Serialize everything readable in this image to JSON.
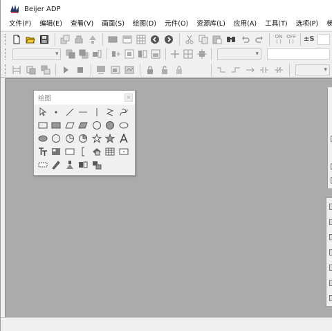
{
  "window": {
    "title": "Beijer ADP"
  },
  "menu": [
    "文件(F)",
    "编辑(E)",
    "查看(V)",
    "画面(S)",
    "绘图(D)",
    "元件(O)",
    "资源库(L)",
    "应用(A)",
    "工具(T)",
    "选项(P)",
    "梯形图编"
  ],
  "toolbar": {
    "on_label_top": "ON",
    "on_label_bottom": "( )",
    "off_label_top": "OFF",
    "off_label_bottom": "( )",
    "pm_label": "±S"
  },
  "palette": {
    "title": "绘图",
    "close": "×"
  },
  "icons": {
    "toolbar1": [
      "new-file-icon",
      "open-folder-icon",
      "save-icon",
      "project-settings-icon",
      "transfer-icon",
      "tree-icon",
      "screen-icon",
      "screen-alt-icon",
      "grid-icon",
      "back-icon",
      "forward-icon",
      "cut-icon",
      "copy-icon",
      "paste-icon",
      "find-icon",
      "undo-icon",
      "redo-icon"
    ],
    "palette": [
      "select-arrow-icon",
      "point-icon",
      "line-icon",
      "hline-icon",
      "vline-icon",
      "zigzag-icon",
      "curve-icon",
      "rect-icon",
      "filled-rect-icon",
      "parallelogram-icon",
      "filled-parallelogram-icon",
      "circle-icon",
      "filled-circle-icon",
      "ellipse-icon",
      "filled-ellipse-icon",
      "circle2-icon",
      "pie-icon",
      "pie2-icon",
      "star-icon",
      "filled-star-icon",
      "text-a-icon",
      "text-tt-icon",
      "image-icon",
      "frame-icon",
      "bracket-icon",
      "object-icon",
      "table-icon",
      "dot-box-icon",
      "dashed-line-icon",
      "pen-icon",
      "symbol-icon",
      "component-icon",
      "component2-icon"
    ]
  }
}
